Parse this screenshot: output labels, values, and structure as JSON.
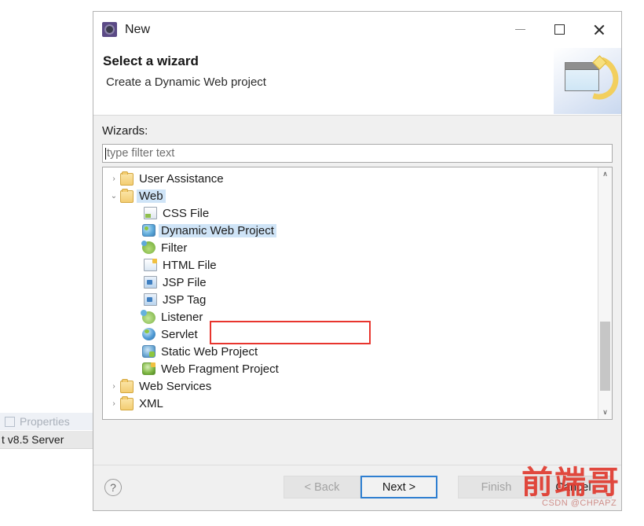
{
  "workbench": {
    "properties_tab": "Properties",
    "server_row": "t v8.5 Server"
  },
  "dialog": {
    "title": "New",
    "header_title": "Select a wizard",
    "header_subtitle": "Create a Dynamic Web project",
    "window_controls": {
      "minimize": "—",
      "maximize": "□",
      "close": "✕"
    },
    "wizards_label": "Wizards:",
    "filter": {
      "value": "",
      "placeholder": "type filter text"
    },
    "tree": {
      "items": [
        {
          "label": "User Assistance",
          "icon": "folder-icon",
          "level": 0,
          "twisty": "›",
          "selected": false
        },
        {
          "label": "Web",
          "icon": "folder-icon",
          "level": 0,
          "twisty": "⌄",
          "selected": true
        },
        {
          "label": "CSS File",
          "icon": "css-file-icon",
          "level": 1,
          "twisty": "",
          "selected": false
        },
        {
          "label": "Dynamic Web Project",
          "icon": "dynamic-web-icon",
          "level": 1,
          "twisty": "",
          "selected": true
        },
        {
          "label": "Filter",
          "icon": "filter-icon",
          "level": 1,
          "twisty": "",
          "selected": false
        },
        {
          "label": "HTML File",
          "icon": "html-file-icon",
          "level": 1,
          "twisty": "",
          "selected": false
        },
        {
          "label": "JSP File",
          "icon": "jsp-file-icon",
          "level": 1,
          "twisty": "",
          "selected": false
        },
        {
          "label": "JSP Tag",
          "icon": "jsp-tag-icon",
          "level": 1,
          "twisty": "",
          "selected": false
        },
        {
          "label": "Listener",
          "icon": "listener-icon",
          "level": 1,
          "twisty": "",
          "selected": false
        },
        {
          "label": "Servlet",
          "icon": "servlet-icon",
          "level": 1,
          "twisty": "",
          "selected": false
        },
        {
          "label": "Static Web Project",
          "icon": "static-web-icon",
          "level": 1,
          "twisty": "",
          "selected": false
        },
        {
          "label": "Web Fragment Project",
          "icon": "web-fragment-icon",
          "level": 1,
          "twisty": "",
          "selected": false
        },
        {
          "label": "Web Services",
          "icon": "folder-icon",
          "level": 0,
          "twisty": "›",
          "selected": false
        },
        {
          "label": "XML",
          "icon": "folder-icon",
          "level": 0,
          "twisty": "›",
          "selected": false
        }
      ],
      "scrollbar": {
        "up_arrow": "∧",
        "down_arrow": "∨"
      }
    },
    "footer": {
      "help_label": "?",
      "buttons": [
        {
          "label": "< Back",
          "state": "disabled"
        },
        {
          "label": "Next >",
          "state": "primary"
        },
        {
          "label": "Finish",
          "state": "disabled"
        },
        {
          "label": "Cancel",
          "state": "normal"
        }
      ]
    }
  },
  "annotation": {
    "color": "#e8352e",
    "target": "Dynamic Web Project"
  },
  "watermark": {
    "text": "前端哥",
    "credit": "CSDN @CHPAPZ",
    "color": "#e03a2f"
  }
}
